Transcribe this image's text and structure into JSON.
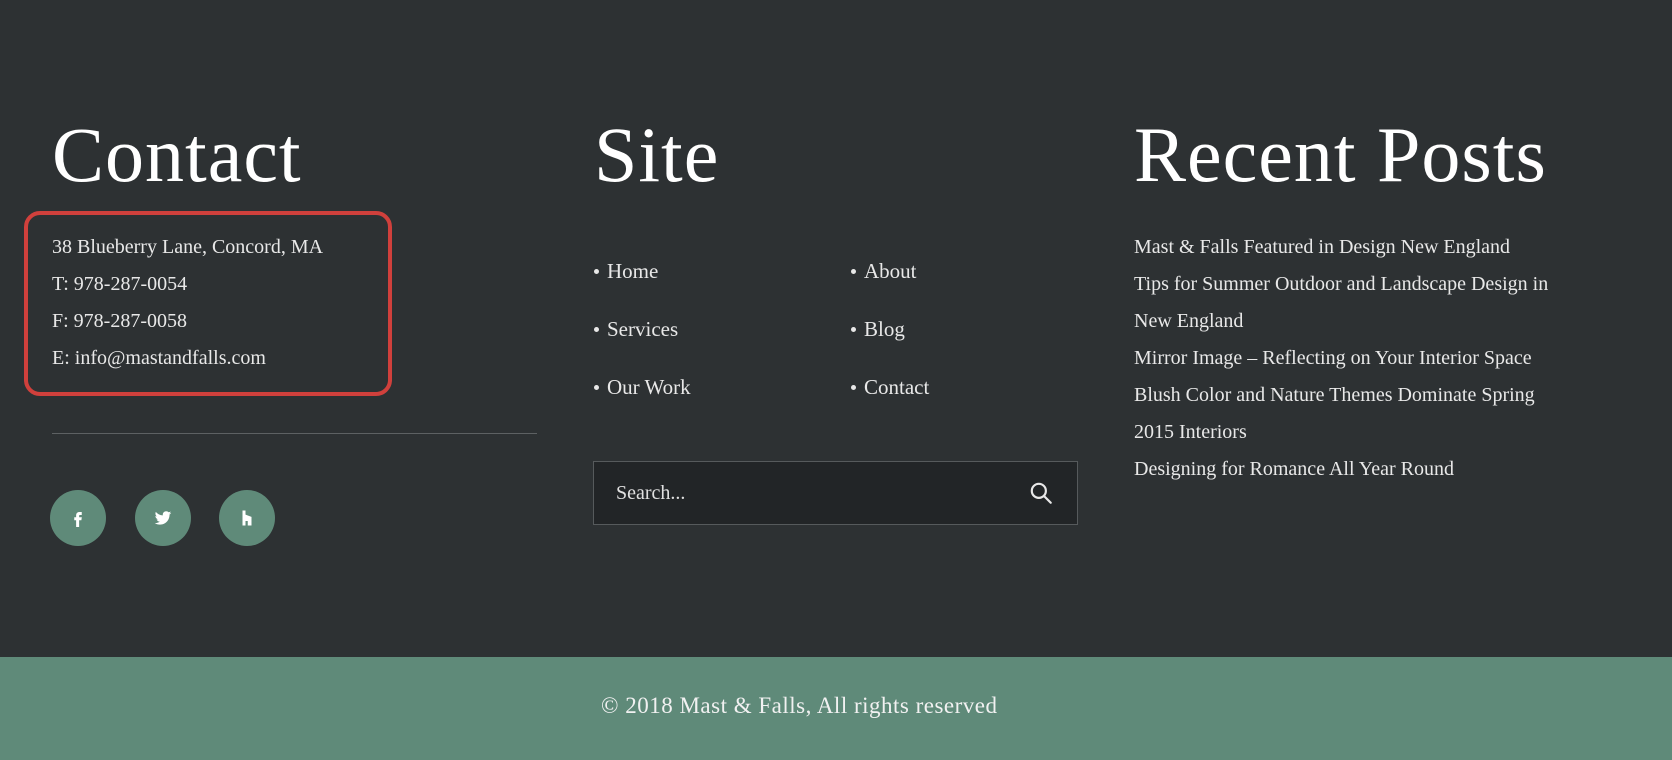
{
  "contact": {
    "title": "Contact",
    "address": "38 Blueberry Lane, Concord, MA",
    "phone": "T: 978-287-0054",
    "fax": "F: 978-287-0058",
    "email": "E: info@mastandfalls.com",
    "social": [
      {
        "name": "facebook-icon",
        "glyph": "f"
      },
      {
        "name": "twitter-icon",
        "glyph": "bird"
      },
      {
        "name": "houzz-icon",
        "glyph": "h"
      }
    ]
  },
  "site": {
    "title": "Site",
    "nav": [
      "Home",
      "About",
      "Services",
      "Blog",
      "Our Work",
      "Contact"
    ],
    "search_placeholder": "Search..."
  },
  "recent_posts": {
    "title": "Recent Posts",
    "lines": [
      "Mast & Falls Featured in Design New England",
      "Tips for Summer Outdoor and Landscape Design in",
      "New England",
      "Mirror Image – Reflecting on Your Interior Space",
      "Blush Color and Nature Themes Dominate Spring",
      "2015 Interiors",
      "Designing for Romance All Year Round"
    ]
  },
  "footer": {
    "copyright": "© 2018 Mast & Falls, All rights reserved"
  },
  "colors": {
    "background": "#2d3133",
    "accent_green": "#5f8a79",
    "highlight_red": "#d0403c"
  }
}
